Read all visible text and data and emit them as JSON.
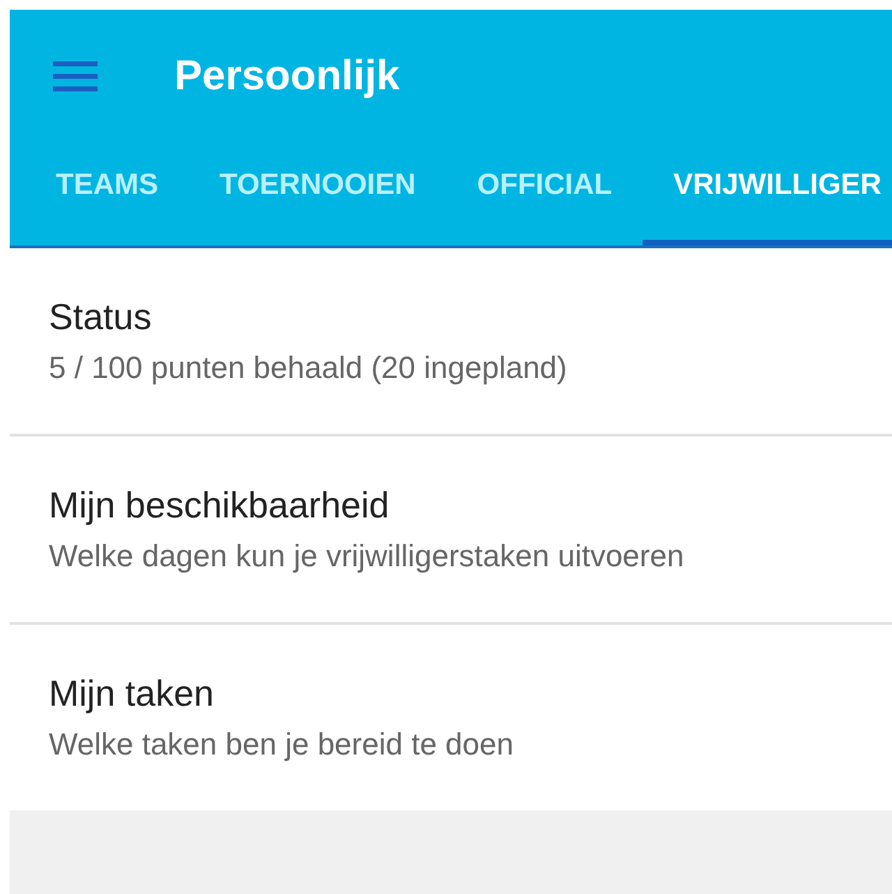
{
  "app_bar": {
    "title": "Persoonlijk"
  },
  "tabs": [
    {
      "label": "TEAMS",
      "selected": false
    },
    {
      "label": "TOERNOOIEN",
      "selected": false
    },
    {
      "label": "OFFICIAL",
      "selected": false
    },
    {
      "label": "VRIJWILLIGER",
      "selected": true
    }
  ],
  "items": [
    {
      "title": "Status",
      "subtitle": "5 / 100 punten behaald (20 ingepland)"
    },
    {
      "title": "Mijn beschikbaarheid",
      "subtitle": "Welke dagen kun je vrijwilligerstaken uitvoeren"
    },
    {
      "title": "Mijn taken",
      "subtitle": "Welke taken ben je bereid te doen"
    }
  ]
}
